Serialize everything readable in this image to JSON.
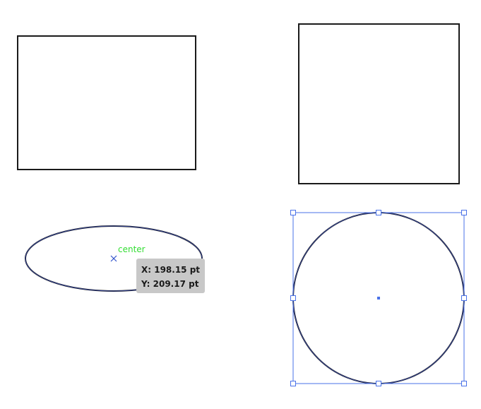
{
  "canvas": {
    "shapes": [
      {
        "kind": "rectangle",
        "name": "rectangle-shape"
      },
      {
        "kind": "square",
        "name": "square-shape"
      },
      {
        "kind": "ellipse",
        "name": "ellipse-shape"
      },
      {
        "kind": "circle",
        "name": "circle-shape",
        "selected": true
      }
    ]
  },
  "smart_guide": {
    "label": "center",
    "color": "#33dd33",
    "marker_color": "#3355cc"
  },
  "tooltip": {
    "x_text": "X: 198.15 pt",
    "y_text": "Y: 209.17 pt",
    "background": "#c8c8c8"
  },
  "selection": {
    "color": "#4a72e8",
    "handles": 8
  },
  "colors": {
    "stroke": "#1a1a1a",
    "path_outline": "#2a3a8a",
    "selection": "#4a72e8"
  }
}
